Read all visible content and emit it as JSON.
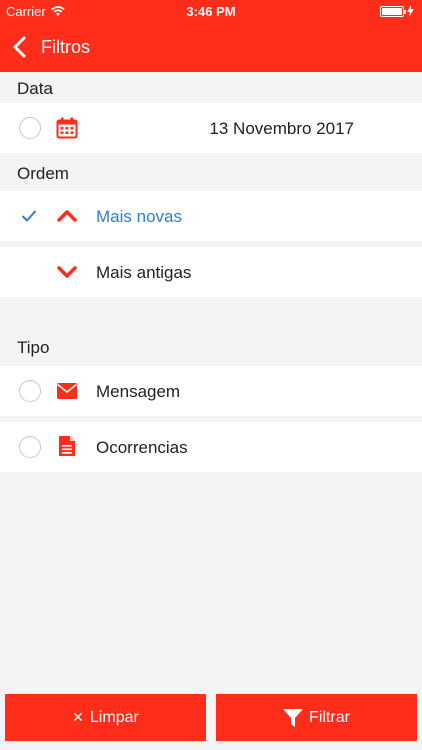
{
  "status_bar": {
    "carrier": "Carrier",
    "time": "3:46 PM",
    "battery_level": 1.0
  },
  "nav": {
    "title": "Filtros"
  },
  "sections": {
    "date": {
      "header": "Data",
      "value": "13 Novembro 2017"
    },
    "order": {
      "header": "Ordem",
      "options": [
        {
          "label": "Mais novas",
          "selected": true
        },
        {
          "label": "Mais antigas",
          "selected": false
        }
      ]
    },
    "type": {
      "header": "Tipo",
      "options": [
        {
          "label": "Mensagem",
          "icon": "envelope-icon"
        },
        {
          "label": "Ocorrencias",
          "icon": "document-icon"
        }
      ]
    }
  },
  "buttons": {
    "clear_label": "Limpar",
    "filter_label": "Filtrar"
  },
  "colors": {
    "accent": "#ff2d1a",
    "selected_text": "#2f7fd6",
    "background": "#f4f4f4"
  }
}
